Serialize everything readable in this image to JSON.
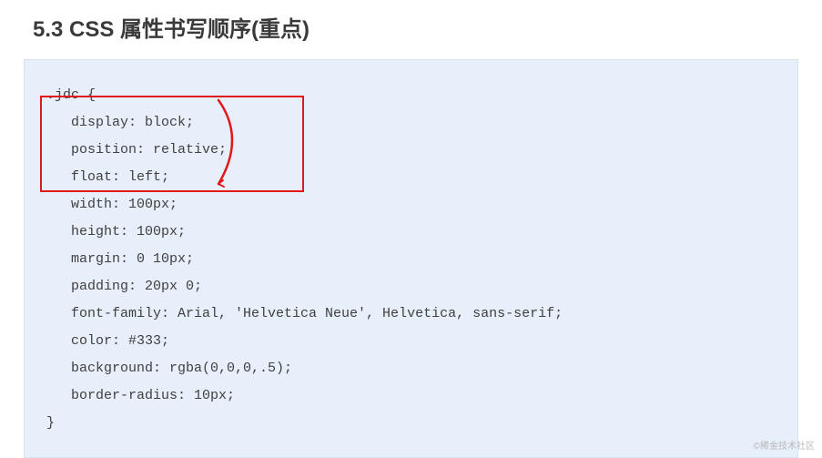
{
  "heading": "5.3 CSS 属性书写顺序(重点)",
  "code": {
    "l1": ".jdc {",
    "l2": "   display: block;",
    "l3": "   position: relative;",
    "l4": "   float: left;",
    "l5": "   width: 100px;",
    "l6": "   height: 100px;",
    "l7": "   margin: 0 10px;",
    "l8": "   padding: 20px 0;",
    "l9": "   font-family: Arial, 'Helvetica Neue', Helvetica, sans-serif;",
    "l10": "   color: #333;",
    "l11": "   background: rgba(0,0,0,.5);",
    "l12": "   border-radius: 10px;",
    "l13": "}"
  },
  "watermark": "©稀金技术社区"
}
